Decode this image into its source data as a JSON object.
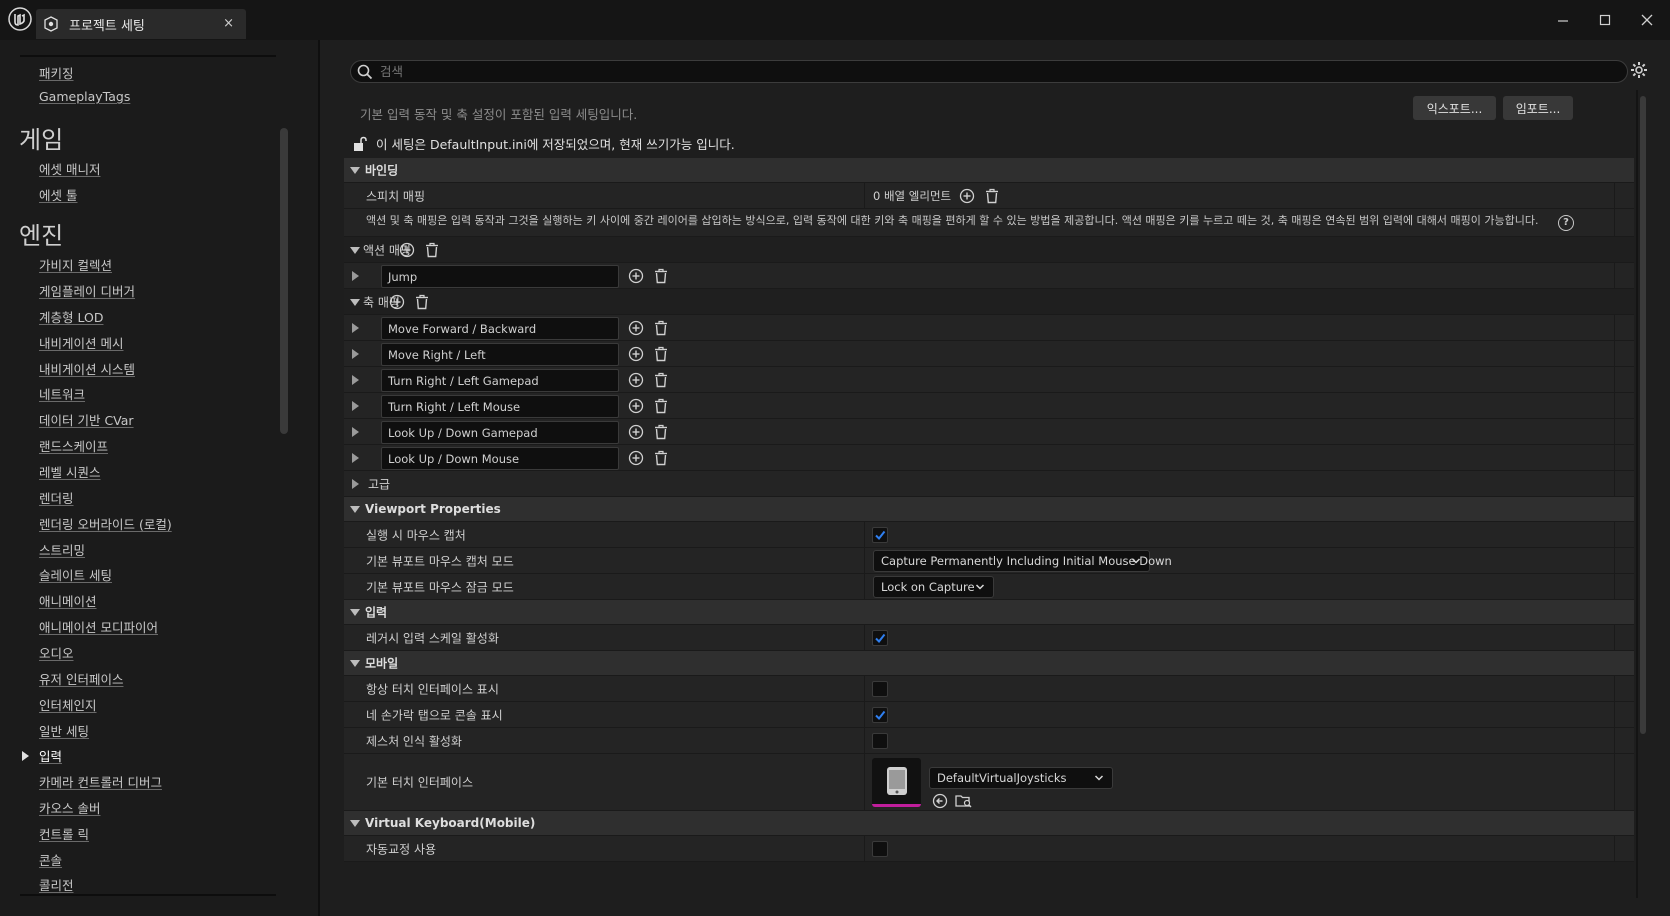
{
  "window": {
    "tab_title": "프로젝트 세팅",
    "tab_close": "×",
    "logo_icon": "unreal-logo-icon",
    "controls": [
      "minimize-icon",
      "maximize-icon",
      "close-icon"
    ]
  },
  "sidebar": {
    "items_top": [
      "패키징",
      "GameplayTags"
    ],
    "cat_game": "게임",
    "items_game": [
      "에셋 매니저",
      "에셋 툴"
    ],
    "cat_engine": "엔진",
    "items_engine": [
      "가비지 컬렉션",
      "게임플레이 디버거",
      "계층형 LOD",
      "내비게이션 메시",
      "내비게이션 시스템",
      "네트워크",
      "데이터 기반 CVar",
      "랜드스케이프",
      "레벨 시퀀스",
      "렌더링",
      "렌더링 오버라이드 (로컬)",
      "스트리밍",
      "슬레이트 세팅",
      "애니메이션",
      "애니메이션 모디파이어",
      "오디오",
      "유저 인터페이스",
      "인터체인지",
      "일반 세팅",
      "입력",
      "카메라 컨트롤러 디버그",
      "카오스 솔버",
      "컨트롤 릭",
      "콘솔",
      "콜리전"
    ],
    "selected": "입력"
  },
  "main": {
    "search_placeholder": "검색",
    "description": "기본 입력 동작 및 축 설정이 포함된 입력 세팅입니다.",
    "export_label": "익스포트...",
    "import_label": "임포트...",
    "lock_text": "이 세팅은 DefaultInput.ini에 저장되었으며, 현재 쓰기가능 입니다.",
    "sections": {
      "bindings": "바인딩",
      "viewport": "Viewport Properties",
      "input": "입력",
      "mobile": "모바일",
      "vkeyboard": "Virtual Keyboard(Mobile)"
    },
    "speech_mapping": {
      "label": "스피치 매핑",
      "value": "0 배열 엘리먼트"
    },
    "mapping_desc": "액션 및 축 매핑은 입력 동작과 그것을 실행하는 키 사이에 중간 레이어를 삽입하는 방식으로, 입력 동작에 대한 키와 축 매핑을 편하게 할 수 있는 방법을 제공합니다. 액션 매핑은 키를 누르고 떼는 것, 축 매핑은 연속된 범위 입력에 대해서 매핑이 가능합니다.",
    "help_glyph": "?",
    "action_mapping_label": "액션 매핑",
    "action_mappings": [
      "Jump"
    ],
    "axis_mapping_label": "축 매핑",
    "axis_mappings": [
      "Move Forward / Backward",
      "Move Right / Left",
      "Turn Right / Left Gamepad",
      "Turn Right / Left Mouse",
      "Look Up / Down Gamepad",
      "Look Up / Down Mouse"
    ],
    "advanced_label": "고급",
    "viewport_rows": {
      "capture_on_play": {
        "label": "실행 시 마우스 캡처",
        "checked": true
      },
      "capture_mode": {
        "label": "기본 뷰포트 마우스 캡처 모드",
        "value": "Capture Permanently Including Initial Mouse Down"
      },
      "lock_mode": {
        "label": "기본 뷰포트 마우스 잠금 모드",
        "value": "Lock on Capture"
      }
    },
    "input_rows": {
      "legacy_scale": {
        "label": "레거시 입력 스케일 활성화",
        "checked": true
      }
    },
    "mobile_rows": {
      "always_show_touch": {
        "label": "항상 터치 인터페이스 표시",
        "checked": false
      },
      "four_finger_console": {
        "label": "네 손가락 탭으로 콘솔 표시",
        "checked": true
      },
      "gesture": {
        "label": "제스처 인식 활성화",
        "checked": false
      },
      "default_touch": {
        "label": "기본 터치 인터페이스",
        "value": "DefaultVirtualJoysticks"
      }
    },
    "vkeyboard_rows": {
      "autocorrect": {
        "label": "자동교정 사용",
        "checked": false
      }
    }
  }
}
